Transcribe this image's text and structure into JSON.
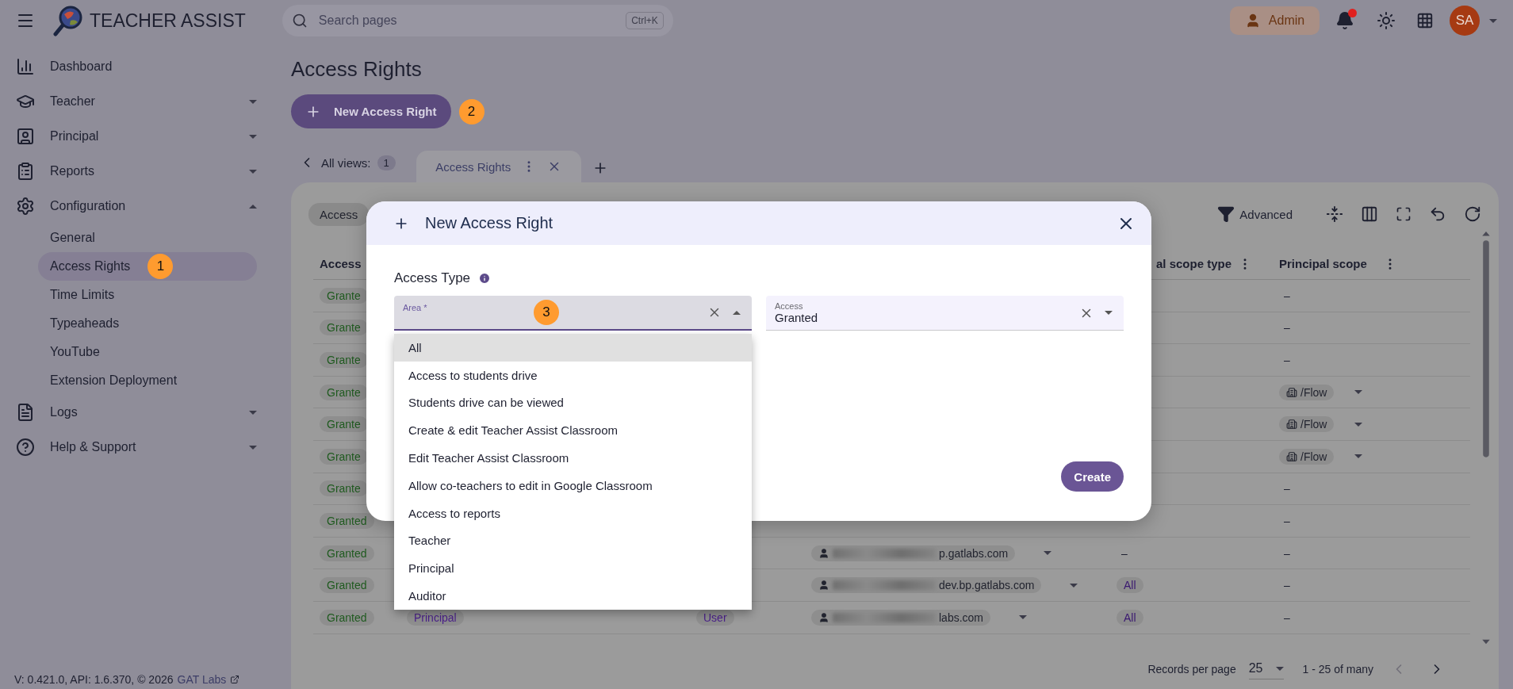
{
  "header": {
    "app_title": "TEACHER ASSIST",
    "search": {
      "placeholder": "Search pages",
      "shortcut": "Ctrl+K"
    },
    "role": "Admin",
    "notifications": {
      "unread": true
    },
    "avatar": "SA"
  },
  "sidebar": {
    "items": [
      {
        "label": "Dashboard"
      },
      {
        "label": "Teacher",
        "expanded": false
      },
      {
        "label": "Principal",
        "expanded": false
      },
      {
        "label": "Reports",
        "expanded": false
      },
      {
        "label": "Configuration",
        "expanded": true,
        "children": [
          {
            "label": "General",
            "selected": false
          },
          {
            "label": "Access Rights",
            "selected": true,
            "marker": "1"
          },
          {
            "label": "Time Limits",
            "selected": false
          },
          {
            "label": "Typeaheads",
            "selected": false
          },
          {
            "label": "YouTube",
            "selected": false
          },
          {
            "label": "Extension Deployment",
            "selected": false
          }
        ]
      },
      {
        "label": "Logs",
        "expanded": false
      },
      {
        "label": "Help & Support",
        "expanded": false
      }
    ],
    "footer": {
      "version": "V: 0.421.0, API: 1.6.370, © 2026",
      "link": "GAT Labs"
    }
  },
  "page": {
    "title": "Access Rights",
    "new_button": {
      "label": "New Access Right",
      "marker": "2"
    }
  },
  "views": {
    "back_label": "All views:",
    "count": "1",
    "tabs": [
      {
        "label": "Access Rights",
        "selected": true
      }
    ]
  },
  "table": {
    "filter_chip": "Access",
    "advanced": "Advanced",
    "columns": {
      "access": "Access",
      "principal_scope_type": "al scope type",
      "principal_scope": "Principal scope"
    },
    "rows": [
      {
        "access": "Grante",
        "scope": {
          "kind": "dash",
          "text": "–"
        }
      },
      {
        "access": "Grante",
        "scope": {
          "kind": "dash",
          "text": "–"
        }
      },
      {
        "access": "Grante",
        "scope": {
          "kind": "dash",
          "text": "–"
        }
      },
      {
        "access": "Grante",
        "scope": {
          "kind": "org",
          "text": "/Flow"
        }
      },
      {
        "access": "Grante",
        "scope": {
          "kind": "org",
          "text": "/Flow"
        }
      },
      {
        "access": "Grante",
        "scope": {
          "kind": "org",
          "text": "/Flow"
        }
      },
      {
        "access": "Grante",
        "scope": {
          "kind": "dash",
          "text": "–"
        }
      },
      {
        "access": "Granted",
        "scope": {
          "kind": "dash",
          "text": "–"
        }
      },
      {
        "access": "Granted",
        "principal": "p.gatlabs.com",
        "scope_type": {
          "kind": "dash",
          "text": "–"
        },
        "scope": {
          "kind": "dash",
          "text": "–"
        }
      },
      {
        "access": "Granted",
        "principal": "dev.bp.gatlabs.com",
        "scope_type": {
          "kind": "chip",
          "text": "All"
        },
        "scope": {
          "kind": "dash",
          "text": "–"
        }
      },
      {
        "access": "Granted",
        "area": "Principal",
        "type": "User",
        "principal": "labs.com",
        "scope_type": {
          "kind": "chip",
          "text": "All"
        },
        "scope": {
          "kind": "dash",
          "text": "–"
        }
      }
    ],
    "pagination": {
      "label": "Records per page",
      "page_size": "25",
      "range": "1 - 25 of many",
      "prev_disabled": true,
      "next_disabled": false
    }
  },
  "dialog": {
    "title": "New Access Right",
    "section": "Access Type",
    "fields": [
      {
        "label": "Area *",
        "open": true,
        "marker": "3"
      },
      {
        "label": "Access",
        "value": "Granted",
        "open": false
      }
    ],
    "options": [
      {
        "label": "All",
        "highlighted": true
      },
      {
        "label": "Access to students drive",
        "highlighted": false
      },
      {
        "label": "Students drive can be viewed",
        "highlighted": false
      },
      {
        "label": "Create & edit Teacher Assist Classroom",
        "highlighted": false
      },
      {
        "label": "Edit Teacher Assist Classroom",
        "highlighted": false
      },
      {
        "label": "Allow co-teachers to edit in Google Classroom",
        "highlighted": false
      },
      {
        "label": "Access to reports",
        "highlighted": false
      },
      {
        "label": "Teacher",
        "highlighted": false
      },
      {
        "label": "Principal",
        "highlighted": false
      },
      {
        "label": "Auditor",
        "highlighted": false
      }
    ],
    "submit": "Create"
  }
}
